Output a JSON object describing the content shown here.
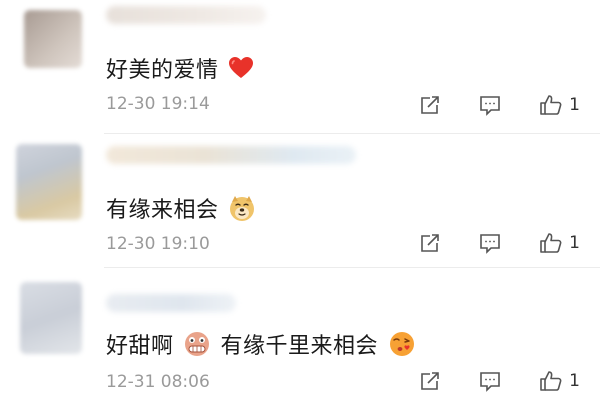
{
  "comments": [
    {
      "text_before": "好美的爱情",
      "emoji_after": "heart-emoji",
      "time": "12-30 19:14",
      "like_count": "1"
    },
    {
      "text_before": "有缘来相会",
      "emoji_after": "doge-emoji",
      "time": "12-30 19:10",
      "like_count": "1"
    },
    {
      "text_before": "好甜啊",
      "emoji_mid": "grimace-emoji",
      "text_after": "有缘千里来相会",
      "emoji_after": "kiss-emoji",
      "time": "12-31 08:06",
      "like_count": "1"
    }
  ],
  "icons": {
    "share": "share-icon",
    "reply": "comment-icon",
    "like": "thumbs-up-icon"
  },
  "colors": {
    "meta_text": "#9a9a9a",
    "divider": "#ececec",
    "heart": "#e8322a"
  }
}
